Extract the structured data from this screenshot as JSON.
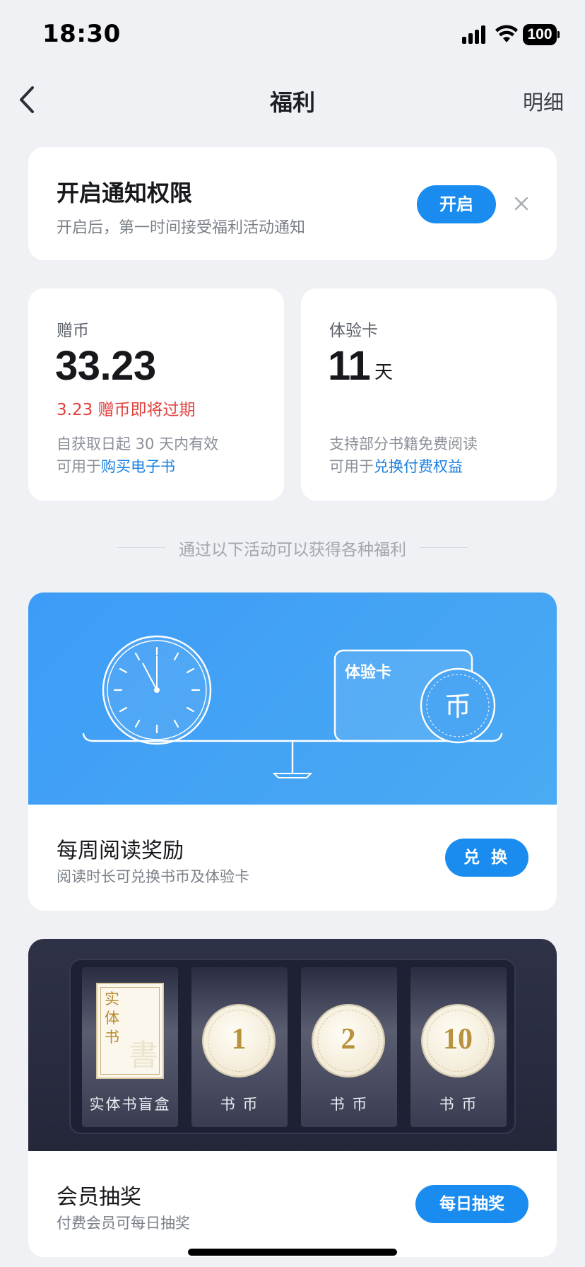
{
  "status_bar": {
    "time": "18:30",
    "battery": "100"
  },
  "nav": {
    "title": "福利",
    "detail": "明细",
    "back_icon": "chevron-left-icon"
  },
  "notification": {
    "title": "开启通知权限",
    "subtitle": "开启后，第一时间接受福利活动通知",
    "button": "开启",
    "close_icon": "close-icon"
  },
  "balances": {
    "coins": {
      "label": "赠币",
      "value": "33.23",
      "warning": "3.23 赠币即将过期",
      "desc1": "自获取日起 30 天内有效",
      "desc2_prefix": "可用于",
      "desc2_link": "购买电子书"
    },
    "trial_card": {
      "label": "体验卡",
      "value": "11",
      "unit": "天",
      "desc1": "支持部分书籍免费阅读",
      "desc2_prefix": "可用于",
      "desc2_link": "兑换付费权益"
    }
  },
  "divider_text": "通过以下活动可以获得各种福利",
  "weekly": {
    "banner_card_label": "体验卡",
    "banner_coin_glyph": "币",
    "title": "每周阅读奖励",
    "subtitle": "阅读时长可兑换书币及体验卡",
    "button": "兑 换"
  },
  "lottery": {
    "slots": [
      {
        "book_text": "实体书",
        "watermark": "書",
        "label": "实体书盲盒"
      },
      {
        "coin": "1",
        "label": "书 币"
      },
      {
        "coin": "2",
        "label": "书 币"
      },
      {
        "coin": "10",
        "label": "书 币"
      }
    ],
    "title": "会员抽奖",
    "subtitle": "付费会员可每日抽奖",
    "button": "每日抽奖"
  },
  "colors": {
    "accent": "#1a8cf0",
    "warning": "#e2403c",
    "link": "#1a7fe0",
    "banner_blue": "#3d9cf7",
    "banner_dark": "#2a2d42"
  }
}
